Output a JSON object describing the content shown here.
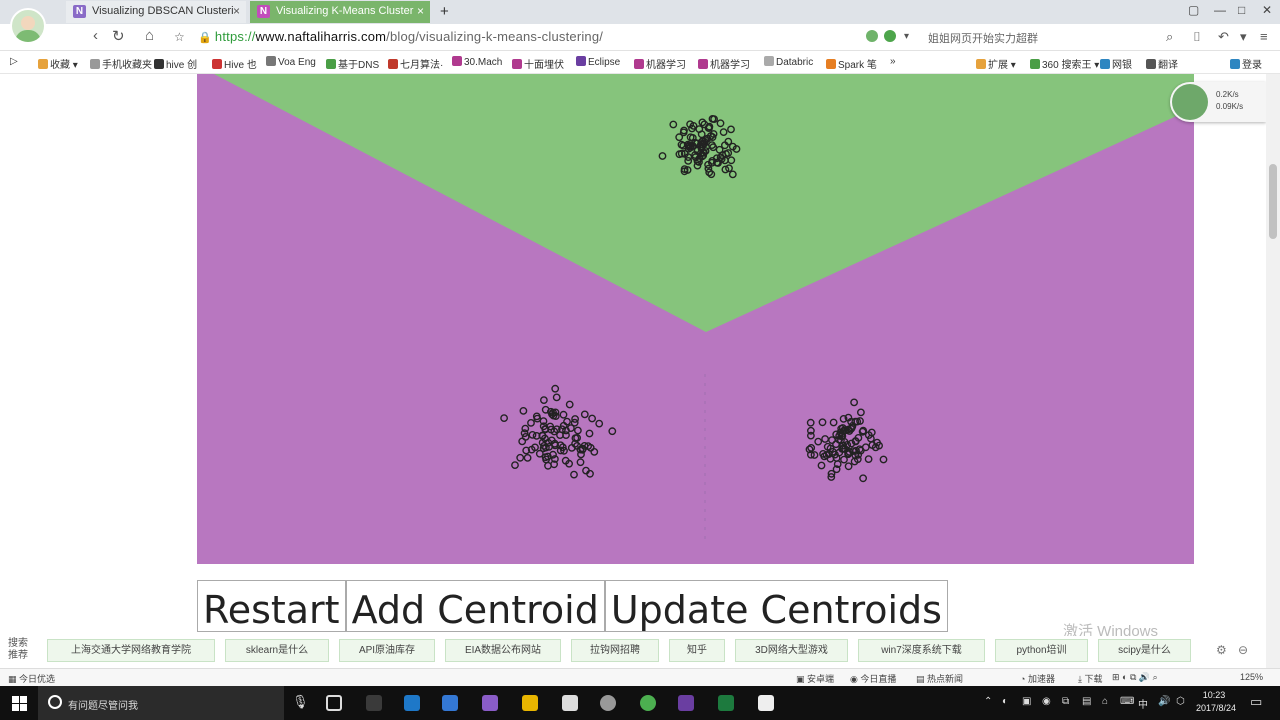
{
  "tabs": [
    {
      "label": "Visualizing DBSCAN Clusteri",
      "icon": "N"
    },
    {
      "label": "Visualizing K-Means Cluster",
      "icon": "N"
    }
  ],
  "address": {
    "scheme": "https://",
    "host": "www.naftaliharris.com",
    "path": "/blog/visualizing-k-means-clustering/",
    "search_hint": "姐姐网页开始实力超群"
  },
  "bookmarks": [
    "收藏",
    "手机收藏夹",
    "hive 创",
    "Hive 也",
    "Voa Eng",
    "基于DNS",
    "七月算法·",
    "30.Mach",
    "十面埋伏",
    "Eclipse",
    "机器学习",
    "机器学习",
    "Databric",
    "Spark 笔",
    "扩展",
    "360 搜索王",
    "网银",
    "翻译",
    "登录"
  ],
  "speed_widget": {
    "down": "0.2K/s",
    "up": "0.09K/s"
  },
  "controls": {
    "restart": "Restart",
    "add_centroid": "Add Centroid",
    "update_centroids": "Update Centroids"
  },
  "watermark": "激活 Windows",
  "suggest": {
    "label": "搜索推荐",
    "items": [
      "上海交通大学网络教育学院",
      "sklearn是什么",
      "API原油库存",
      "EIA数据公布网站",
      "拉钩网招聘",
      "知乎",
      "3D网络大型游戏",
      "win7深度系统下载",
      "python培训",
      "scipy是什么"
    ]
  },
  "statusbar": {
    "left": "今日优选",
    "items": [
      "安卓端",
      "今日直播",
      "热点新闻",
      "加速器",
      "下载"
    ],
    "zoom": "125%"
  },
  "taskbar": {
    "cortana": "有问题尽管问我",
    "ime": "中",
    "time": "10:23",
    "date": "2017/8/24"
  },
  "colors": {
    "green_region": "#86c47c",
    "purple_region": "#b877c0",
    "point_stroke": "#222222"
  },
  "clusters": [
    {
      "name": "top",
      "region": "green"
    },
    {
      "name": "bottom-left",
      "region": "purple"
    },
    {
      "name": "bottom-right",
      "region": "purple"
    }
  ]
}
